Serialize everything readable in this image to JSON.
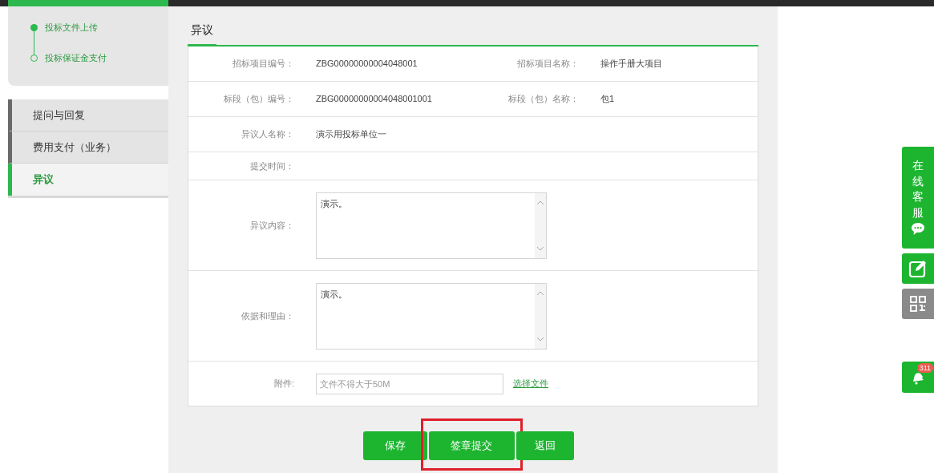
{
  "steps": [
    {
      "label": "投标文件上传",
      "done": true
    },
    {
      "label": "投标保证金支付",
      "done": false
    }
  ],
  "menu": [
    {
      "label": "提问与回复",
      "selected": false
    },
    {
      "label": "费用支付（业务）",
      "selected": false
    },
    {
      "label": "异议",
      "selected": true
    }
  ],
  "tabs": [
    {
      "label": "异议",
      "selected": true
    }
  ],
  "form": [
    {
      "kind": "pair",
      "cells": [
        {
          "label": "招标项目编号：",
          "value": "ZBG00000000004048001"
        },
        {
          "label": "招标项目名称：",
          "value": "操作手册大项目"
        }
      ]
    },
    {
      "kind": "pair",
      "cells": [
        {
          "label": "标段（包）编号：",
          "value": "ZBG00000000004048001001"
        },
        {
          "label": "标段（包）名称：",
          "value": "包1"
        }
      ]
    },
    {
      "kind": "text",
      "label": "异议人名称：",
      "value": "演示用投标单位一"
    },
    {
      "kind": "text",
      "label": "提交时间："
    },
    {
      "kind": "textarea",
      "label": "异议内容：",
      "value": "演示。"
    },
    {
      "kind": "textarea",
      "label": "依据和理由：",
      "value": "演示。"
    },
    {
      "kind": "file",
      "label": "附件:",
      "placeholder": "文件不得大于50M",
      "link": "选择文件"
    }
  ],
  "buttons": [
    {
      "label": "保存",
      "highlighted": false
    },
    {
      "label": "签章提交",
      "highlighted": true
    },
    {
      "label": "返回",
      "highlighted": false
    }
  ],
  "side_tools": {
    "service": "在线客服",
    "badge": "311"
  }
}
